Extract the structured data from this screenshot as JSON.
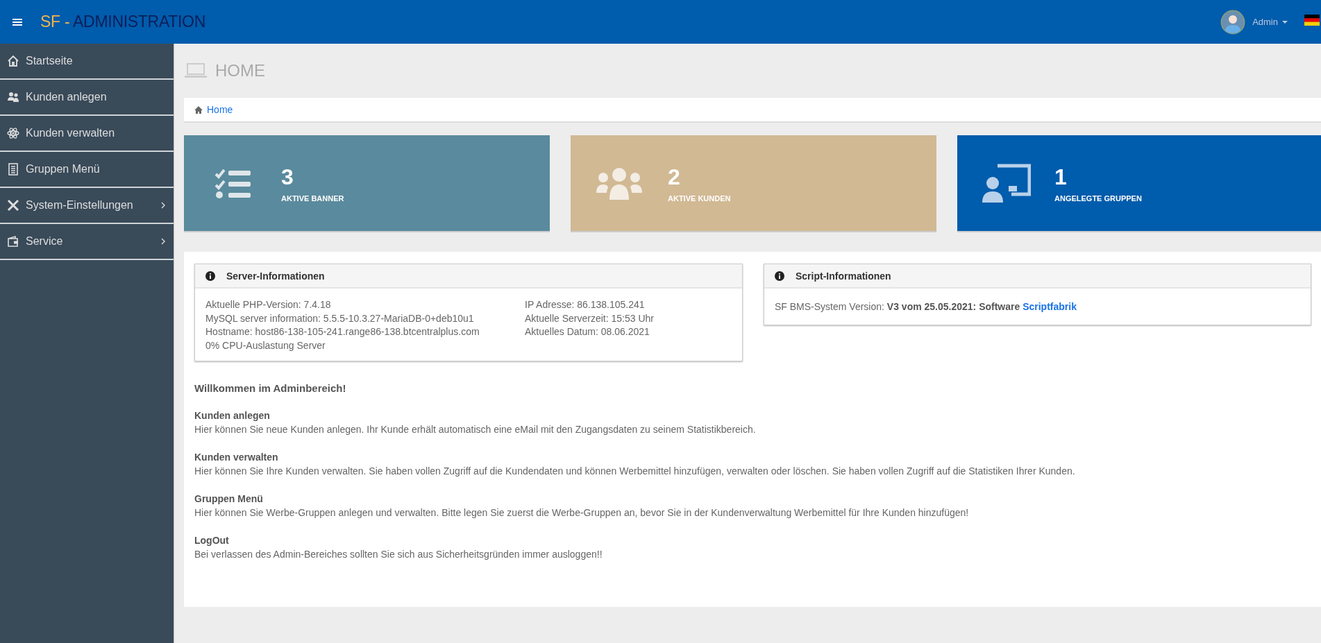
{
  "header": {
    "brand_prefix": "SF -",
    "brand_name": "ADMINISTRATION",
    "user": "Admin"
  },
  "sidebar": {
    "items": [
      {
        "label": "Startseite",
        "submenu": false,
        "selected": false
      },
      {
        "label": "Kunden anlegen",
        "submenu": false,
        "selected": false
      },
      {
        "label": "Kunden verwalten",
        "submenu": false,
        "selected": false
      },
      {
        "label": "Gruppen Menü",
        "submenu": false,
        "selected": false
      },
      {
        "label": "System-Einstellungen",
        "submenu": true,
        "selected": false
      },
      {
        "label": "Service",
        "submenu": true,
        "selected": false
      }
    ]
  },
  "page": {
    "title": "HOME",
    "breadcrumb": "Home"
  },
  "stats": [
    {
      "value": "3",
      "label": "AKTIVE BANNER",
      "color": "#5a8a9d"
    },
    {
      "value": "2",
      "label": "AKTIVE KUNDEN",
      "color": "#d1b994"
    },
    {
      "value": "1",
      "label": "ANGELEGTE GRUPPEN",
      "color": "#005cac"
    }
  ],
  "server_panel": {
    "title": "Server-Informationen",
    "left": [
      "Aktuelle PHP-Version: 7.4.18",
      "MySQL server information: 5.5.5-10.3.27-MariaDB-0+deb10u1",
      "Hostname: host86-138-105-241.range86-138.btcentralplus.com",
      "0% CPU-Auslastung Server"
    ],
    "right": [
      "IP Adresse: 86.138.105.241",
      "Aktuelle Serverzeit: 15:53 Uhr",
      "Aktuelles Datum: 08.06.2021"
    ]
  },
  "script_panel": {
    "title": "Script-Informationen",
    "text": "SF BMS-System Version: **V3 vom 25.05.2021: Software** ",
    "link": "Scriptfabrik"
  },
  "welcome": {
    "title": "Willkommen im Adminbereich!",
    "sections": [
      {
        "heading": "Kunden anlegen",
        "text": "Hier können Sie neue Kunden anlegen. Ihr Kunde erhält automatisch eine eMail mit den Zugangsdaten zu seinem Statistikbereich."
      },
      {
        "heading": "Kunden verwalten",
        "text": "Hier können Sie Ihre Kunden verwalten. Sie haben vollen Zugriff auf die Kundendaten und können Werbemittel hinzufügen, verwalten oder löschen. Sie haben vollen Zugriff auf die Statistiken Ihrer Kunden."
      },
      {
        "heading": "Gruppen Menü",
        "text": "Hier können Sie Werbe-Gruppen anlegen und verwalten. Bitte legen Sie zuerst die Werbe-Gruppen an, bevor Sie in der Kundenverwaltung Werbemittel für Ihre Kunden hinzufügen!"
      },
      {
        "heading": "LogOut",
        "text": "Bei verlassen des Admin-Bereiches sollten Sie sich aus Sicherheitsgründen immer ausloggen!!"
      }
    ]
  }
}
